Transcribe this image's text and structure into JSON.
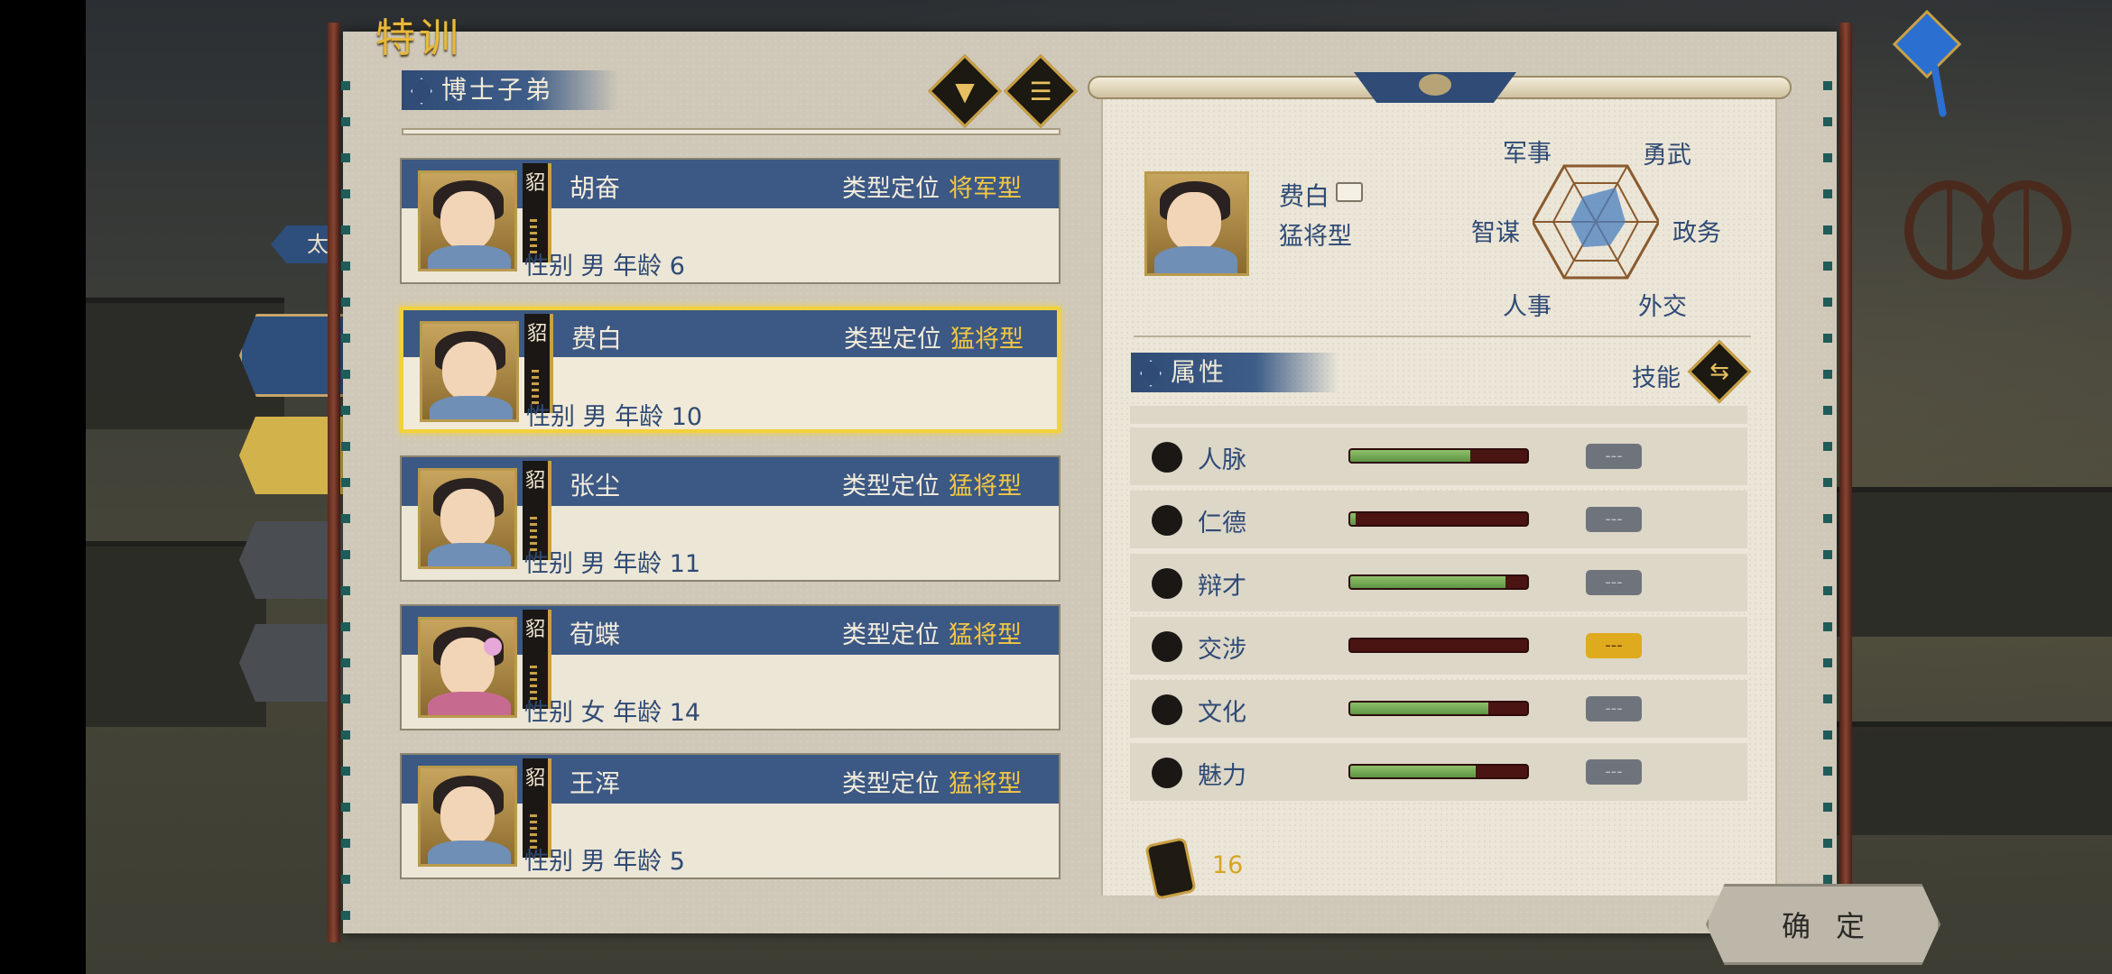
{
  "title": "特训",
  "side_tab_label": "太",
  "list_header": "博士子弟",
  "filter_icon": "filter-icon",
  "menu_icon": "list-icon",
  "students": [
    {
      "badge": "貂",
      "name": "胡奋",
      "type_label": "类型定位",
      "type_value": "将军型",
      "info": "性别 男  年龄 6",
      "selected": false,
      "robe": "blue"
    },
    {
      "badge": "貂",
      "name": "费白",
      "type_label": "类型定位",
      "type_value": "猛将型",
      "info": "性别 男  年龄 10",
      "selected": true,
      "robe": "blue"
    },
    {
      "badge": "貂",
      "name": "张尘",
      "type_label": "类型定位",
      "type_value": "猛将型",
      "info": "性别 男  年龄 11",
      "selected": false,
      "robe": "blue"
    },
    {
      "badge": "貂",
      "name": "荀蝶",
      "type_label": "类型定位",
      "type_value": "猛将型",
      "info": "性别 女  年龄 14",
      "selected": false,
      "robe": "pink"
    },
    {
      "badge": "貂",
      "name": "王浑",
      "type_label": "类型定位",
      "type_value": "猛将型",
      "info": "性别 男  年龄 5",
      "selected": false,
      "robe": "blue"
    }
  ],
  "detail": {
    "name": "费白",
    "type": "猛将型",
    "radar_labels": {
      "top_left": "军事",
      "top_right": "勇武",
      "left": "智谋",
      "right": "政务",
      "bottom_left": "人事",
      "bottom_right": "外交"
    },
    "attr_header": "属性",
    "skill_label": "技能",
    "attributes": [
      {
        "name": "人脉",
        "level": 0.68,
        "value": "---",
        "highlight": false
      },
      {
        "name": "仁德",
        "level": 0.03,
        "value": "---",
        "highlight": false
      },
      {
        "name": "辩才",
        "level": 0.88,
        "value": "---",
        "highlight": false
      },
      {
        "name": "交涉",
        "level": 0.0,
        "value": "---",
        "highlight": true
      },
      {
        "name": "文化",
        "level": 0.78,
        "value": "---",
        "highlight": false
      },
      {
        "name": "魅力",
        "level": 0.71,
        "value": "---",
        "highlight": false
      }
    ],
    "points": "16"
  },
  "confirm_label": "确定",
  "colors": {
    "accent_gold": "#f3c743",
    "header_blue": "#3c5884",
    "text_blue": "#2f4a74",
    "bar_green": "#5e9444",
    "bar_red": "#4a1412"
  }
}
